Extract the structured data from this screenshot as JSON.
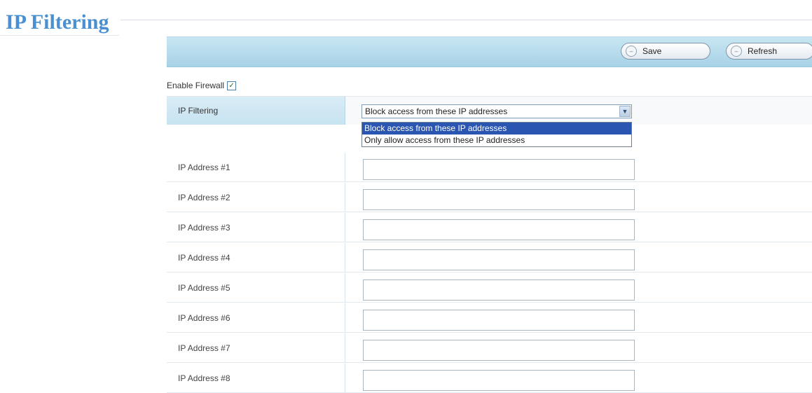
{
  "page": {
    "title": "IP Filtering"
  },
  "toolbar": {
    "save_label": "Save",
    "refresh_label": "Refresh"
  },
  "firewall": {
    "label": "Enable Firewall",
    "checked": true
  },
  "filter": {
    "label": "IP Filtering",
    "selected": "Block access from these IP addresses",
    "options": [
      "Block access from these IP addresses",
      "Only allow access from these IP addresses"
    ]
  },
  "ip_rows": [
    {
      "label": "IP Address #1",
      "value": ""
    },
    {
      "label": "IP Address #2",
      "value": ""
    },
    {
      "label": "IP Address #3",
      "value": ""
    },
    {
      "label": "IP Address #4",
      "value": ""
    },
    {
      "label": "IP Address #5",
      "value": ""
    },
    {
      "label": "IP Address #6",
      "value": ""
    },
    {
      "label": "IP Address #7",
      "value": ""
    },
    {
      "label": "IP Address #8",
      "value": ""
    }
  ]
}
